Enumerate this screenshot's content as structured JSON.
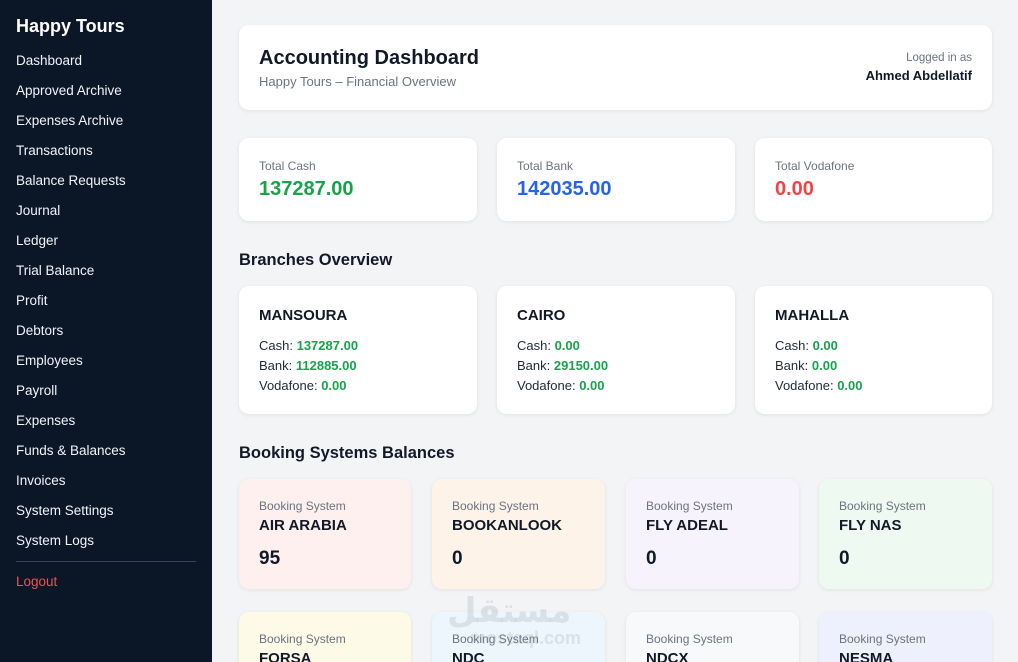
{
  "sidebar": {
    "brand": "Happy Tours",
    "items": [
      {
        "label": "Dashboard"
      },
      {
        "label": "Approved Archive"
      },
      {
        "label": "Expenses Archive"
      },
      {
        "label": "Transactions"
      },
      {
        "label": "Balance Requests"
      },
      {
        "label": "Journal"
      },
      {
        "label": "Ledger"
      },
      {
        "label": "Trial Balance"
      },
      {
        "label": "Profit"
      },
      {
        "label": "Debtors"
      },
      {
        "label": "Employees"
      },
      {
        "label": "Payroll"
      },
      {
        "label": "Expenses"
      },
      {
        "label": "Funds & Balances"
      },
      {
        "label": "Invoices"
      },
      {
        "label": "System Settings"
      },
      {
        "label": "System Logs"
      }
    ],
    "logout": "Logout"
  },
  "header": {
    "title": "Accounting Dashboard",
    "subtitle": "Happy Tours – Financial Overview",
    "logged_in_label": "Logged in as",
    "user": "Ahmed Abdellatif"
  },
  "totals": [
    {
      "label": "Total Cash",
      "value": "137287.00",
      "color": "#16a34a"
    },
    {
      "label": "Total Bank",
      "value": "142035.00",
      "color": "#2563eb"
    },
    {
      "label": "Total Vodafone",
      "value": "0.00",
      "color": "#ef4444"
    }
  ],
  "branches_title": "Branches Overview",
  "branches": [
    {
      "name": "MANSOURA",
      "cash_label": "Cash:",
      "cash": "137287.00",
      "bank_label": "Bank:",
      "bank": "112885.00",
      "vodafone_label": "Vodafone:",
      "vodafone": "0.00"
    },
    {
      "name": "CAIRO",
      "cash_label": "Cash:",
      "cash": "0.00",
      "bank_label": "Bank:",
      "bank": "29150.00",
      "vodafone_label": "Vodafone:",
      "vodafone": "0.00"
    },
    {
      "name": "MAHALLA",
      "cash_label": "Cash:",
      "cash": "0.00",
      "bank_label": "Bank:",
      "bank": "0.00",
      "vodafone_label": "Vodafone:",
      "vodafone": "0.00"
    }
  ],
  "booking_title": "Booking Systems Balances",
  "booking_systems": [
    {
      "label": "Booking System",
      "name": "AIR ARABIA",
      "value": "95",
      "bg": "#fdf0ee"
    },
    {
      "label": "Booking System",
      "name": "BOOKANLOOK",
      "value": "0",
      "bg": "#fdf3e8"
    },
    {
      "label": "Booking System",
      "name": "FLY ADEAL",
      "value": "0",
      "bg": "#f7f3fc"
    },
    {
      "label": "Booking System",
      "name": "FLY NAS",
      "value": "0",
      "bg": "#eefaf1"
    },
    {
      "label": "Booking System",
      "name": "FORSA",
      "value": "",
      "bg": "#fdfbe8"
    },
    {
      "label": "Booking System",
      "name": "NDC",
      "value": "",
      "bg": "#edf5fd"
    },
    {
      "label": "Booking System",
      "name": "NDCX",
      "value": "",
      "bg": "#f8f9fa"
    },
    {
      "label": "Booking System",
      "name": "NESMA",
      "value": "",
      "bg": "#eef0fd"
    }
  ],
  "watermark": {
    "text": "مستقل",
    "sub": "mostaql.com"
  }
}
